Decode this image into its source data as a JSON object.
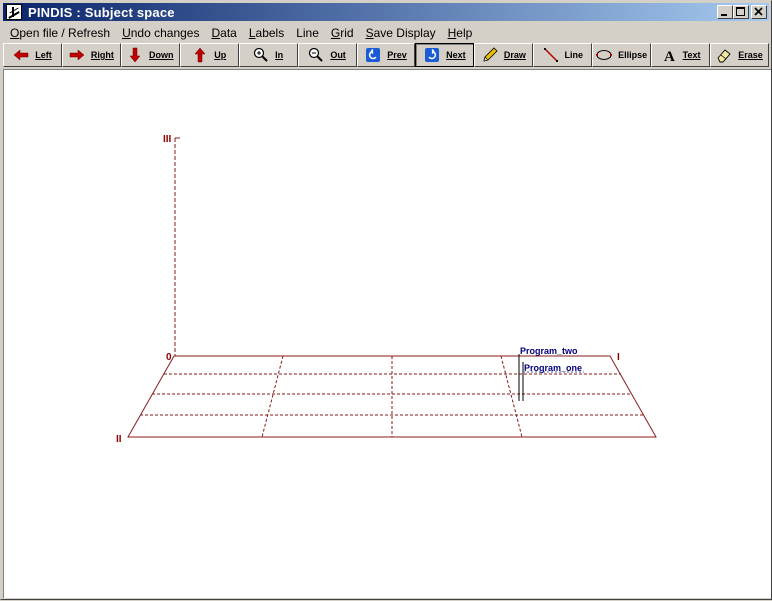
{
  "window": {
    "title": "PINDIS : Subject space"
  },
  "menu": [
    {
      "label": "Open file / Refresh",
      "ul": "O",
      "rest": "pen file / Refresh"
    },
    {
      "label": "Undo changes",
      "ul": "U",
      "rest": "ndo changes"
    },
    {
      "label": "Data",
      "ul": "D",
      "rest": "ata"
    },
    {
      "label": "Labels",
      "ul": "L",
      "rest": "abels"
    },
    {
      "label": "Line",
      "ul": "",
      "rest": "Line"
    },
    {
      "label": "Grid",
      "ul": "G",
      "rest": "rid"
    },
    {
      "label": "Save Display",
      "ul": "S",
      "rest": "ave Display"
    },
    {
      "label": "Help",
      "ul": "H",
      "rest": "elp"
    }
  ],
  "toolbar": {
    "left": "Left",
    "right": "Right",
    "down": "Down",
    "up": "Up",
    "in": "In",
    "out": "Out",
    "prev": "Prev",
    "next": "Next",
    "draw": "Draw",
    "line": "Line",
    "ellipse": "Ellipse",
    "text": "Text",
    "erase": "Erase"
  },
  "plot": {
    "axis_labels": {
      "origin": "0",
      "axis_one": "I",
      "axis_two": "II",
      "axis_three": "III"
    },
    "points": [
      {
        "label": "Program_two"
      },
      {
        "label": "Program_one"
      }
    ],
    "colors": {
      "axis": "#8b0000",
      "grid": "#8b0000",
      "label": "#00007f",
      "plane": "#8b1a1a"
    }
  }
}
